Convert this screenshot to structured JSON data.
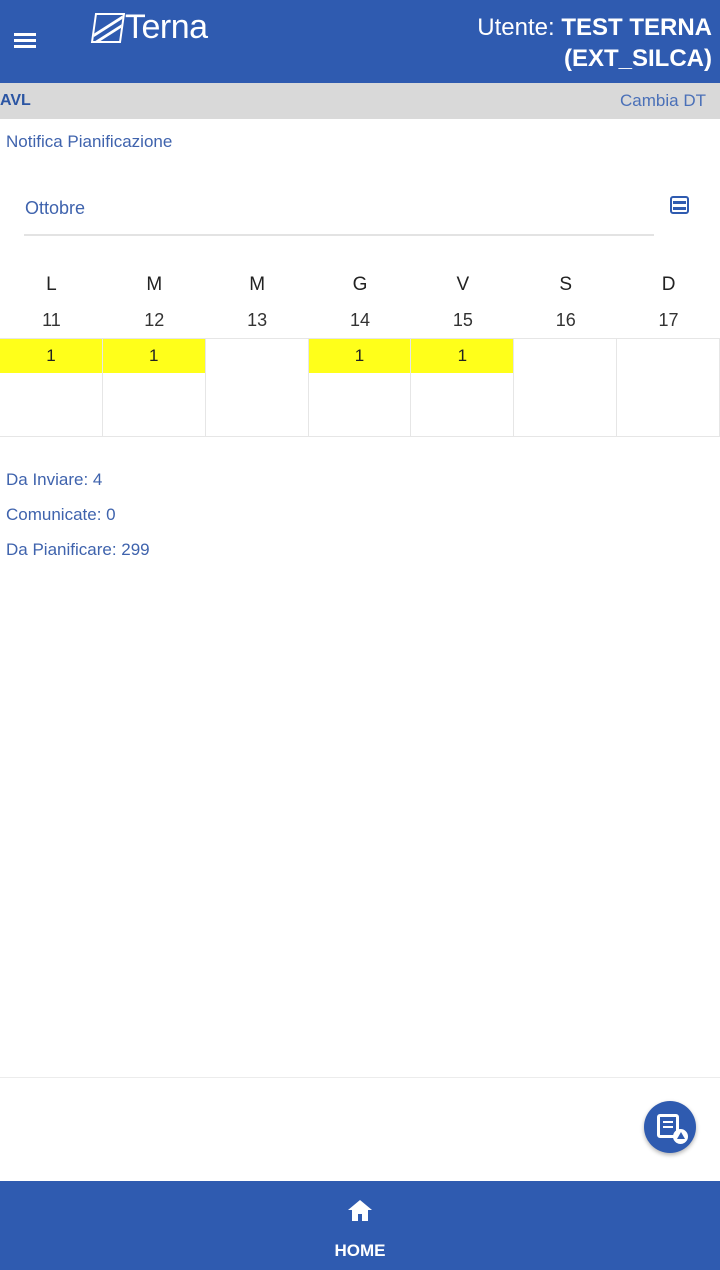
{
  "header": {
    "logo_text": "Terna",
    "user_prefix": "Utente: ",
    "user_name_line1": "TEST TERNA",
    "user_name_line2": "(EXT_SILCA)",
    "color": "#2f5bb0"
  },
  "subbar": {
    "left_label": "AVL",
    "right_label": "Cambia DT"
  },
  "section_title": "Notifica Pianificazione",
  "month_field": {
    "value": "Ottobre"
  },
  "calendar": {
    "day_names": [
      "L",
      "M",
      "M",
      "G",
      "V",
      "S",
      "D"
    ],
    "day_numbers": [
      "11",
      "12",
      "13",
      "14",
      "15",
      "16",
      "17"
    ],
    "counts": [
      "1",
      "1",
      "",
      "1",
      "1",
      "",
      ""
    ],
    "highlight_color": "#ffff1a"
  },
  "stats": {
    "da_inviare": "Da Inviare: 4",
    "comunicate": "Comunicate: 0",
    "da_pianificare": "Da Pianificare: 299"
  },
  "bottom_nav": {
    "home_label": "HOME"
  },
  "icons": {
    "menu": "menu-icon",
    "calendar": "calendar-icon",
    "fab": "document-upload-icon",
    "home": "home-icon"
  }
}
